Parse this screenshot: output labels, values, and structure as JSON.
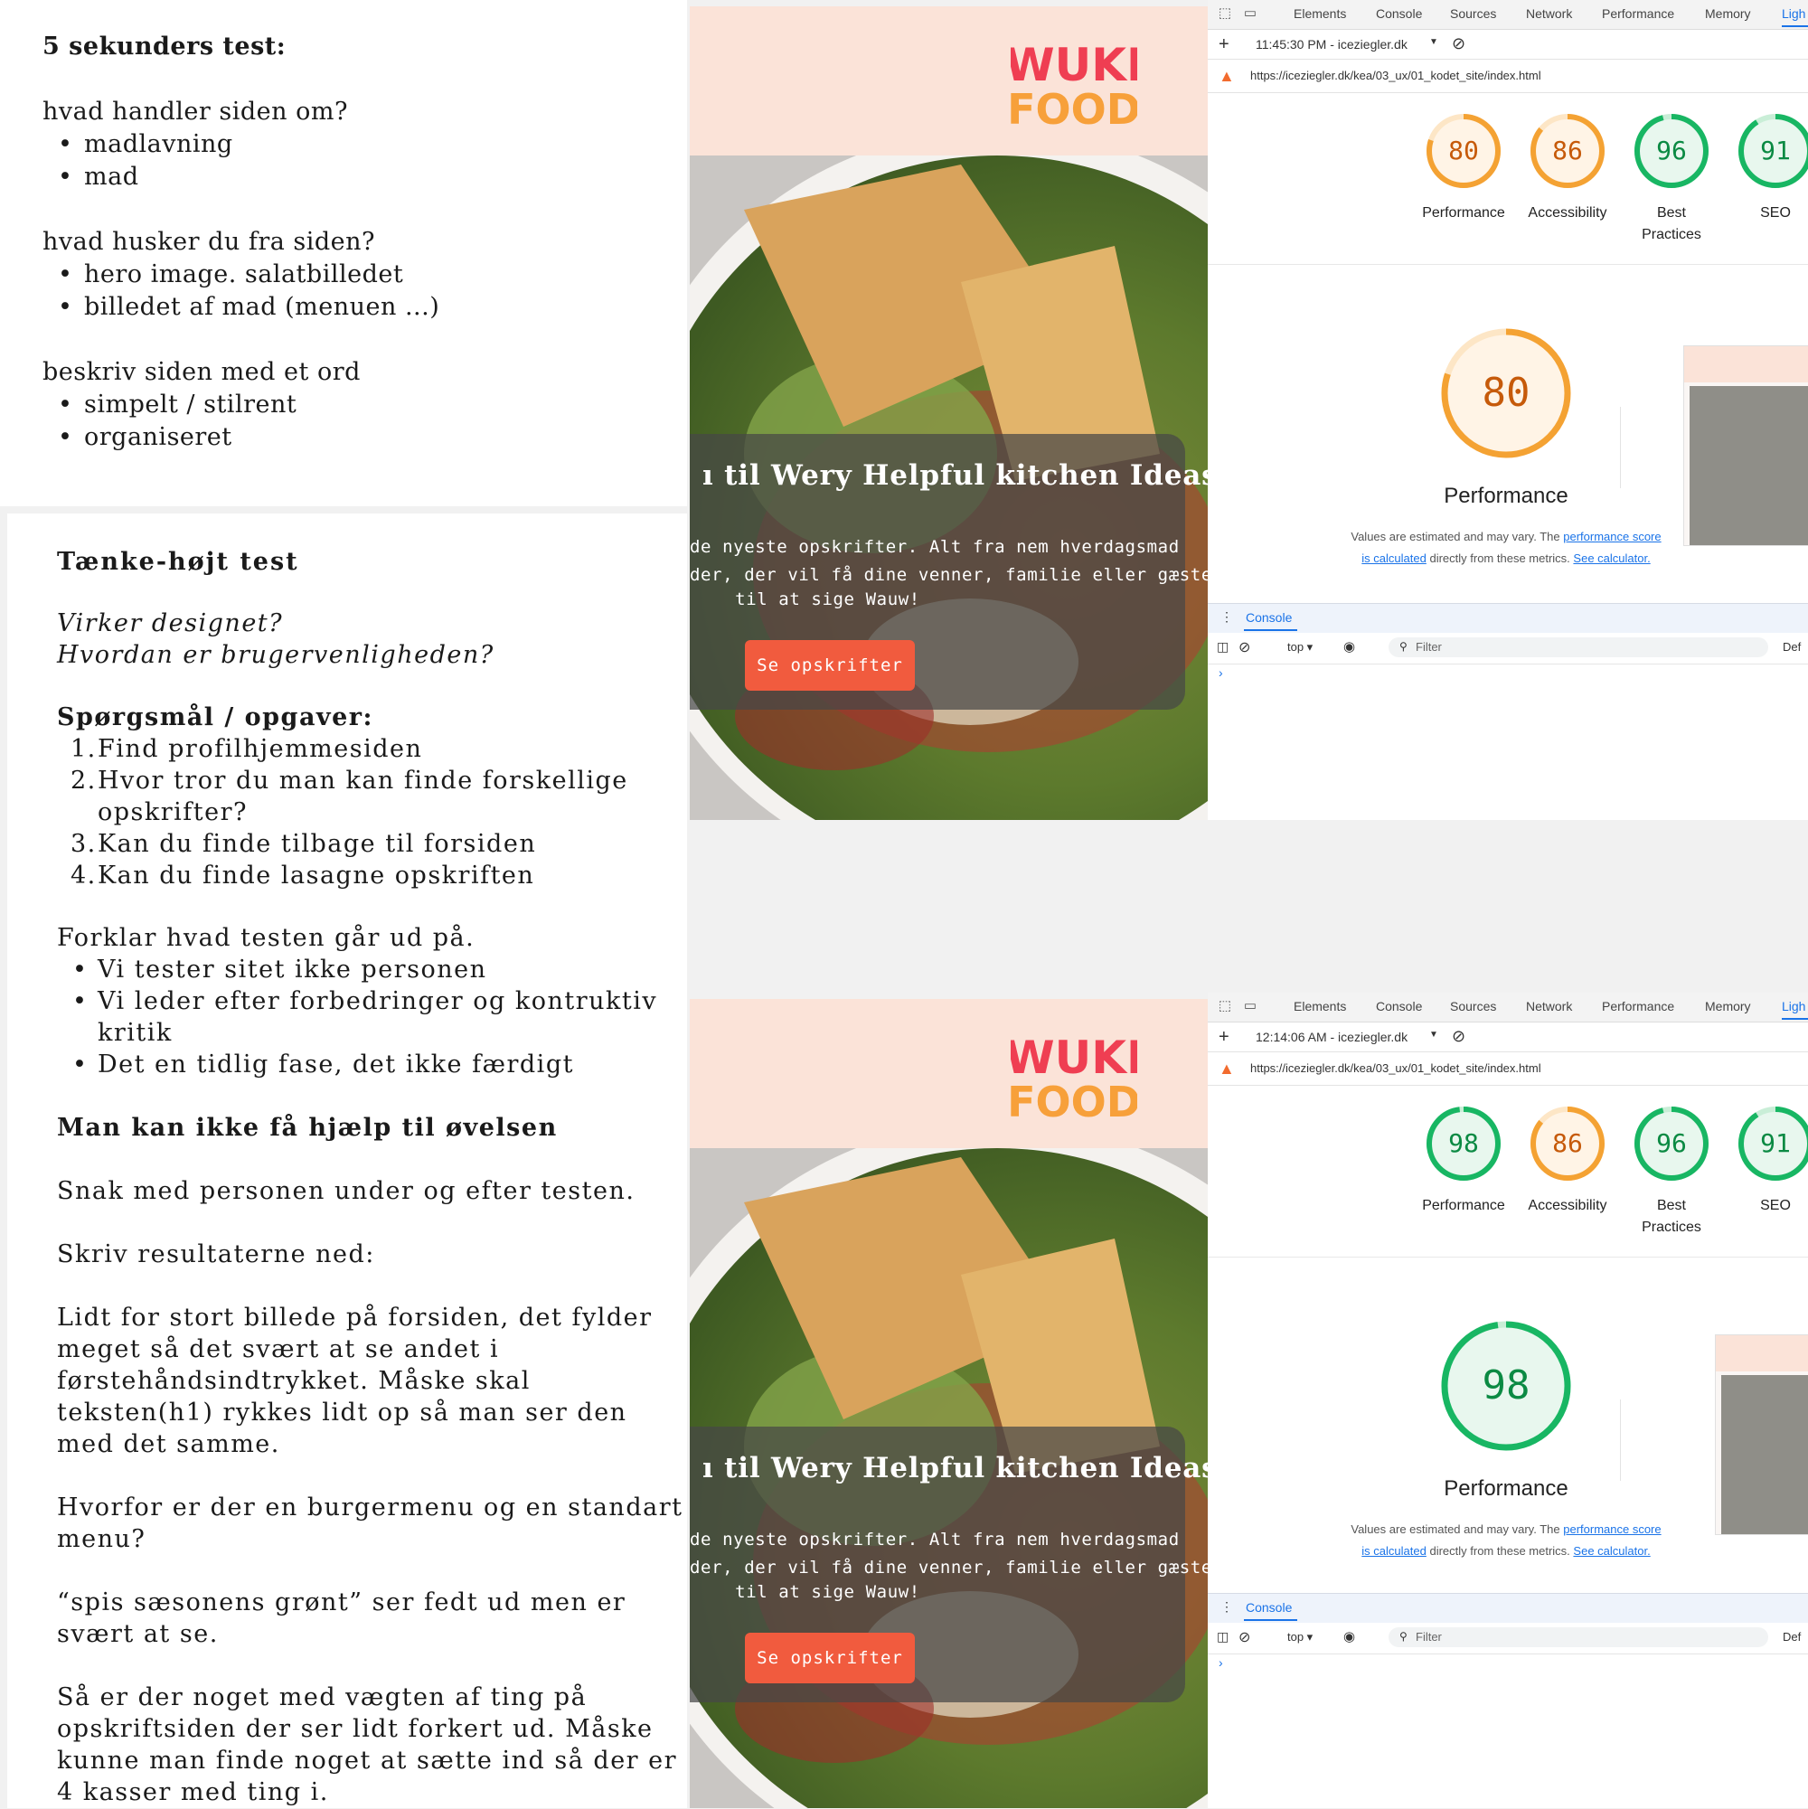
{
  "notes": {
    "five_sec": {
      "title": "5 sekunders test:",
      "q1": "hvad handler siden om?",
      "a1": [
        "madlavning",
        "mad"
      ],
      "q2": "hvad husker du fra siden?",
      "a2": [
        "hero image. salatbilledet",
        "billedet af mad (menuen ...)"
      ],
      "q3": "beskriv siden med et ord",
      "a3": [
        "simpelt / stilrent",
        "organiseret"
      ]
    },
    "think_aloud": {
      "title": "Tænke-højt test",
      "italic1": "Virker designet?",
      "italic2": "Hvordan er brugervenligheden?",
      "tasks_title": "Spørgsmål / opgaver:",
      "tasks": [
        "Find profilhjemmesiden",
        "Hvor tror du man kan finde forskellige",
        "opskrifter?",
        "Kan du finde tilbage til forsiden",
        "Kan du finde lasagne opskriften"
      ],
      "explain": "Forklar hvad testen går ud på.",
      "explain_items": [
        "Vi tester sitet ikke personen",
        "Vi leder efter forbedringer og kontruktiv",
        "kritik",
        "Det en tidlig fase, det ikke færdigt"
      ],
      "no_help": "Man kan ikke få hjælp til øvelsen",
      "talk": "Snak med personen under og efter testen.",
      "write": "Skriv resultaterne ned:",
      "result1": [
        "Lidt for stort billede på forsiden, det fylder",
        "meget så det svært at se andet i",
        "førstehåndsindtrykket. Måske skal",
        "teksten(h1) rykkes lidt op så man ser den",
        "med det samme."
      ],
      "result2": [
        "Hvorfor er der en burgermenu og en standart",
        "menu?"
      ],
      "result3": [
        "“spis sæsonens grønt” ser fedt ud men er",
        "svært at se."
      ],
      "result4": [
        "Så er der noget med vægten af ting på",
        "opskriftsiden der ser lidt forkert ud. Måske",
        "kunne man finde noget at sætte ind så der er",
        "4 kasser med ting i."
      ]
    }
  },
  "site": {
    "logo_top": "WUKI",
    "logo_bottom": "FOOD",
    "hero_title": "ı til Wery Helpful kitchen Ideas",
    "hero_line1": "de nyeste opskrifter. Alt fra nem hverdagsmad",
    "hero_line2": "der, der vil få dine venner, familie eller gæster",
    "hero_line3": "til at sige Wauw!",
    "button": "Se opskrifter"
  },
  "devtools": {
    "tabs": [
      "Elements",
      "Console",
      "Sources",
      "Network",
      "Performance",
      "Memory",
      "Ligh"
    ],
    "url": "https://iceziegler.dk/kea/03_ux/01_kodet_site/index.html",
    "reports": [
      {
        "time": "11:45:30 PM - iceziegler.dk",
        "scores": [
          {
            "value": "80",
            "label": "Performance",
            "color": "#f4a233"
          },
          {
            "value": "86",
            "label": "Accessibility",
            "color": "#f4a233"
          },
          {
            "value": "96",
            "label": "Best Practices",
            "color": "#18b663"
          },
          {
            "value": "91",
            "label": "SEO",
            "color": "#18b663"
          }
        ],
        "big_score": "80",
        "big_color": "#f4a233"
      },
      {
        "time": "12:14:06 AM - iceziegler.dk",
        "scores": [
          {
            "value": "98",
            "label": "Performance",
            "color": "#18b663"
          },
          {
            "value": "86",
            "label": "Accessibility",
            "color": "#f4a233"
          },
          {
            "value": "96",
            "label": "Best Practices",
            "color": "#18b663"
          },
          {
            "value": "91",
            "label": "SEO",
            "color": "#18b663"
          }
        ],
        "big_score": "98",
        "big_color": "#18b663"
      }
    ],
    "big_title": "Performance",
    "note_text": "Values are estimated and may vary. The",
    "note_link1": "performance score",
    "note_link2": "is calculated",
    "note_mid": "directly from these metrics.",
    "note_link3": "See calculator.",
    "console_label": "Console",
    "top_label": "top ▾",
    "filter_label": "Filter",
    "def_label": "Def"
  }
}
